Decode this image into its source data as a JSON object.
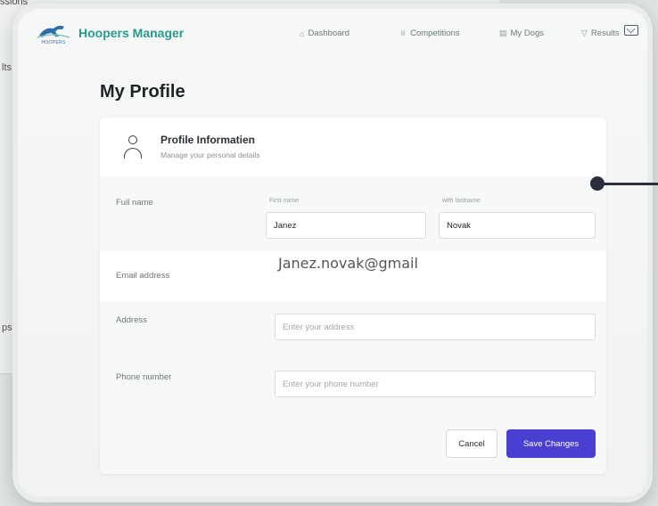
{
  "background": {
    "top_text": "ssions",
    "frag_left_1": "lts",
    "frag_left_2": "ps"
  },
  "nav": {
    "brand": "Hoopers Manager",
    "logo_text": "HOOPERS",
    "items": [
      {
        "label": "Dashboard",
        "icon": "home-icon"
      },
      {
        "label": "Competitions",
        "icon": "trophy-icon"
      },
      {
        "label": "My Dogs",
        "icon": "dog-icon"
      },
      {
        "label": "Results",
        "icon": "filter-icon"
      }
    ],
    "mail_icon": "mail-icon"
  },
  "page": {
    "title": "My Profile"
  },
  "card": {
    "title": "Profile Informatien",
    "subtitle": "Manage your personal details",
    "fields": {
      "full_name_label": "Full name",
      "first_name_label": "First name",
      "last_name_label": "with lastname",
      "first_name_value": "Janez",
      "last_name_value": "Novak",
      "email_label": "Email address",
      "email_value": "Janez.novak@gmail",
      "address_label": "Address",
      "address_placeholder": "Enter your address",
      "phone_label": "Phone number",
      "phone_placeholder": "Enter your phone number"
    },
    "buttons": {
      "cancel": "Cancel",
      "save": "Save Changes"
    }
  },
  "colors": {
    "brand": "#2a9a8a",
    "primary_button": "#4b3fd1"
  }
}
